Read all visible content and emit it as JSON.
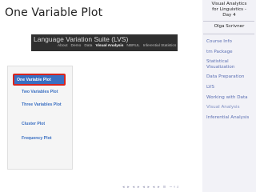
{
  "slide": {
    "title": "One Variable Plot"
  },
  "presentation": {
    "title_lines": [
      "Visual Analytics",
      "for Linguistics -",
      "Day 4"
    ],
    "author": "Olga Scrivner"
  },
  "toc": {
    "items": [
      {
        "label": "Course Info"
      },
      {
        "label": "tm Package"
      },
      {
        "label": "Statistical Visualization"
      },
      {
        "label": "Data Preparation"
      },
      {
        "label": "LVS"
      },
      {
        "label": "Working with Data"
      },
      {
        "label": "Visual Analysis"
      },
      {
        "label": "Inferential Analysis"
      }
    ]
  },
  "app": {
    "brand": "Language Variation Suite (LVS)",
    "nav": [
      "About",
      "Demo",
      "Data",
      "Visual Analysis",
      "NBRUL",
      "Inferential Statistics"
    ],
    "active_nav": "Visual Analysis",
    "sidebar": {
      "selected": "One Variable Plot",
      "items": [
        "Two Variables Plot",
        "Three Variables Plot",
        "Cluster Plot",
        "Frequency Plot"
      ]
    }
  },
  "beamer_nav_symbols": "◂ ▸ ◂ ▸ ◂ ▸ ◂ ▸ ≡ ∽∘⌕"
}
